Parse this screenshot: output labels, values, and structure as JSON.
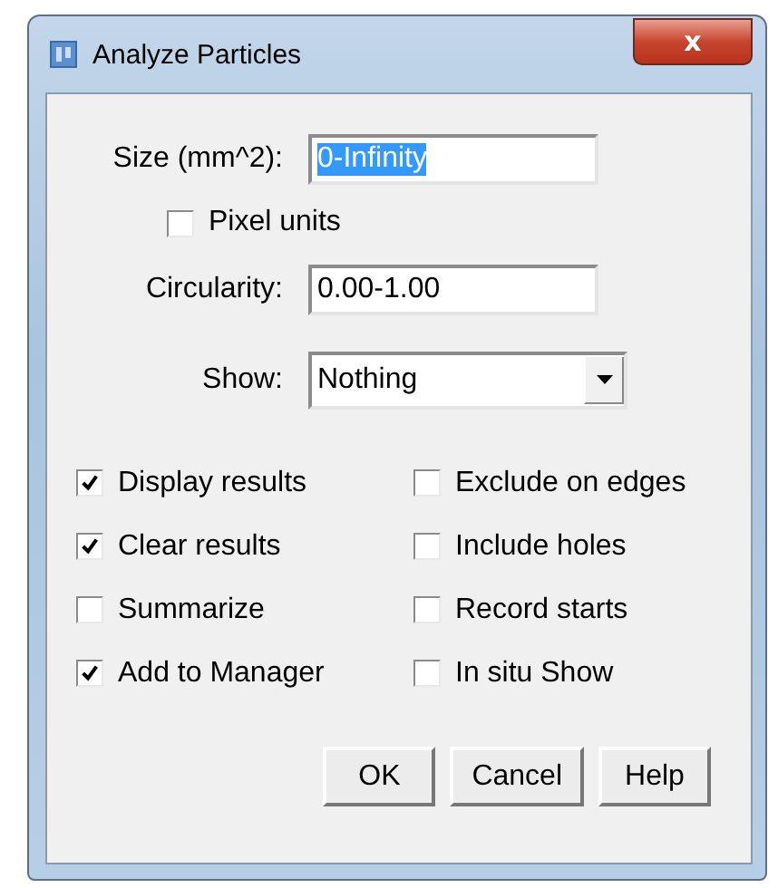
{
  "window": {
    "title": "Analyze Particles",
    "close": "x"
  },
  "form": [
    {
      "kind": "field",
      "label": "Size (mm^2):",
      "value": "0-Infinity",
      "text_selected": true
    },
    {
      "kind": "checkbox",
      "label": "Pixel units",
      "checked": false
    },
    {
      "kind": "field",
      "label": "Circularity:",
      "value": "0.00-1.00",
      "text_selected": false
    },
    {
      "kind": "dropdown",
      "label": "Show:",
      "value": "Nothing"
    }
  ],
  "options": [
    {
      "label": "Display results",
      "checked": true
    },
    {
      "label": "Exclude on edges",
      "checked": false
    },
    {
      "label": "Clear results",
      "checked": true
    },
    {
      "label": "Include holes",
      "checked": false
    },
    {
      "label": "Summarize",
      "checked": false
    },
    {
      "label": "Record starts",
      "checked": false
    },
    {
      "label": "Add to Manager",
      "checked": true
    },
    {
      "label": "In situ Show",
      "checked": false
    }
  ],
  "buttons": [
    "OK",
    "Cancel",
    "Help"
  ]
}
